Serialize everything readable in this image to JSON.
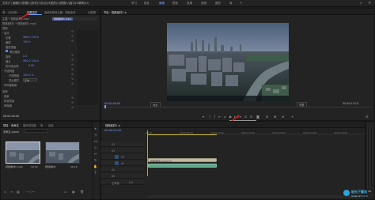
{
  "menu": [
    "文件(F)",
    "编辑(E)",
    "剪辑(C)",
    "序列(S)",
    "标记(M)",
    "图形(G)",
    "视图(V)",
    "窗口(W)",
    "帮助(H)"
  ],
  "workspaces": [
    "学习",
    "组件",
    "编辑",
    "颜色",
    "效果",
    "音频",
    "图形",
    "库"
  ],
  "active_workspace": "编辑",
  "effect_panel": {
    "tabs": [
      "源：(无剪辑)",
      "效果控件",
      "音频剪辑混合器：视频素材",
      "元数据"
    ],
    "active_tab": "效果控件",
    "clip_label": "主要 * 视频素材1.mp4",
    "seq_label": "视频素材1 * 视频素材1.mp4",
    "timecode_badge": "视频素材1.mp4",
    "section_video": "视频",
    "fx_motion": "运动",
    "position_label": "位置",
    "position_value": "960.0  540.0",
    "scale_label": "缩放",
    "scale_value": "100.0",
    "scale_width_label": "缩放宽度",
    "uniform_label": "等比缩放",
    "rotation_label": "旋转",
    "rotation_value": "0.0",
    "anchor_label": "锚点",
    "anchor_value": "960.0  540.0",
    "antiflicker_label": "防闪烁滤镜",
    "antiflicker_value": "0.00",
    "opacity_label": "不透明度",
    "opacity_value": "100.0 %",
    "blend_label": "混合模式",
    "blend_value": "正常",
    "remap_label": "时间重映射",
    "section_audio": "音频",
    "volume_label": "音量",
    "channel_label": "声道音量",
    "panner_label": "声像器",
    "bottom_timecode": "00:00:00:00"
  },
  "program_monitor": {
    "title": "节目：视频素材1 ≡",
    "timecode": "00:00:00:00",
    "fit_label": "适合",
    "full_label": "完整",
    "duration": "00:00:19:19",
    "tooltip": "导出帧 (Shift+E)",
    "export_frame_label": "导出帧"
  },
  "project_panel": {
    "tabs": [
      "项目：未命名",
      "媒体浏览器",
      "库",
      "信息"
    ],
    "active_tab": "项目：未命名",
    "file_label": "未命名.prproj",
    "items": [
      {
        "name": "视频素材1.mp4",
        "duration": "19:19"
      },
      {
        "name": "视频素材1",
        "duration": "19:19"
      }
    ]
  },
  "timeline": {
    "title": "视频素材1 ≡",
    "timecode": "00:00:00:00",
    "ruler": [
      "00:00",
      "00:00:05:00",
      "00:00:10:00",
      "00:00:15:00",
      "00:00:20:00",
      "00:00:25:00",
      "00:00:30:00"
    ],
    "tracks": [
      "V3",
      "V2",
      "V1",
      "A1",
      "A2",
      "A3"
    ],
    "master_label": "主声道",
    "master_value": "0.0",
    "clip_video": "视频素材1.mp4 [V]",
    "clip_audio": "",
    "level_label": "dB"
  },
  "watermark": {
    "title": "极光下载站",
    "url": "www.xz7.com"
  },
  "colors": {
    "accent": "#4f8cff",
    "highlight": "#e0e0e0",
    "clip_video": "#bfb9a0",
    "clip_audio": "#5fa58a",
    "playhead": "#6ea1ff",
    "arrow": "#d32020"
  }
}
